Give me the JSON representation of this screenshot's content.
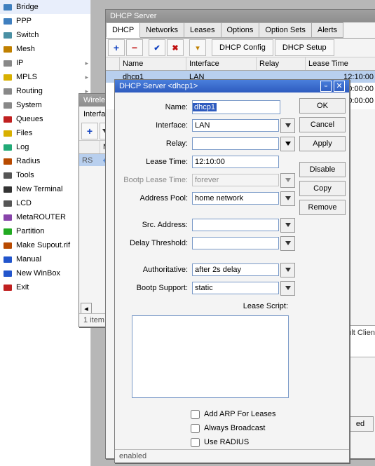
{
  "sidebar": {
    "items": [
      {
        "label": "Bridge"
      },
      {
        "label": "PPP"
      },
      {
        "label": "Switch"
      },
      {
        "label": "Mesh"
      },
      {
        "label": "IP",
        "expand": true
      },
      {
        "label": "MPLS",
        "expand": true
      },
      {
        "label": "Routing",
        "expand": true
      },
      {
        "label": "System",
        "expand": true
      },
      {
        "label": "Queues"
      },
      {
        "label": "Files"
      },
      {
        "label": "Log"
      },
      {
        "label": "Radius"
      },
      {
        "label": "Tools",
        "expand": true
      },
      {
        "label": "New Terminal"
      },
      {
        "label": "LCD"
      },
      {
        "label": "MetaROUTER"
      },
      {
        "label": "Partition"
      },
      {
        "label": "Make Supout.rif"
      },
      {
        "label": "Manual"
      },
      {
        "label": "New WinBox"
      },
      {
        "label": "Exit"
      }
    ]
  },
  "wireless_win": {
    "title": "Wireles",
    "toolbar_tab": "Interfac",
    "col_na": "Na",
    "row_flag": "RS",
    "footer": "1 item ou"
  },
  "dhcp_win": {
    "title": "DHCP Server",
    "tabs": [
      "DHCP",
      "Networks",
      "Leases",
      "Options",
      "Option Sets",
      "Alerts"
    ],
    "btn_config": "DHCP Config",
    "btn_setup": "DHCP Setup",
    "cols": {
      "name": "Name",
      "interface": "Interface",
      "relay": "Relay",
      "lease": "Lease Time"
    },
    "rows": [
      {
        "name": "dhcp1",
        "interface": "LAN",
        "relay": "",
        "lease": "12:10:00"
      },
      {
        "name": "",
        "interface": "",
        "relay": "",
        "lease": "0:00:00"
      },
      {
        "name": "",
        "interface": "",
        "relay": "",
        "lease": "0:00:00"
      }
    ],
    "footer_right": "ult Clien",
    "footer_btn": "ed"
  },
  "dialog": {
    "title": "DHCP Server <dhcp1>",
    "labels": {
      "name": "Name:",
      "interface": "Interface:",
      "relay": "Relay:",
      "lease": "Lease Time:",
      "bootp_lease": "Bootp Lease Time:",
      "pool": "Address Pool:",
      "src": "Src. Address:",
      "delay": "Delay Threshold:",
      "auth": "Authoritative:",
      "support": "Bootp Support:",
      "script": "Lease Script:"
    },
    "values": {
      "name": "dhcp1",
      "interface": "LAN",
      "relay": "",
      "lease": "12:10:00",
      "bootp_lease": "forever",
      "pool": "home network",
      "src": "",
      "delay": "",
      "auth": "after 2s delay",
      "support": "static"
    },
    "checks": {
      "arp": "Add ARP For Leases",
      "broadcast": "Always Broadcast",
      "radius": "Use RADIUS"
    },
    "buttons": {
      "ok": "OK",
      "cancel": "Cancel",
      "apply": "Apply",
      "disable": "Disable",
      "copy": "Copy",
      "remove": "Remove"
    },
    "status": "enabled"
  }
}
